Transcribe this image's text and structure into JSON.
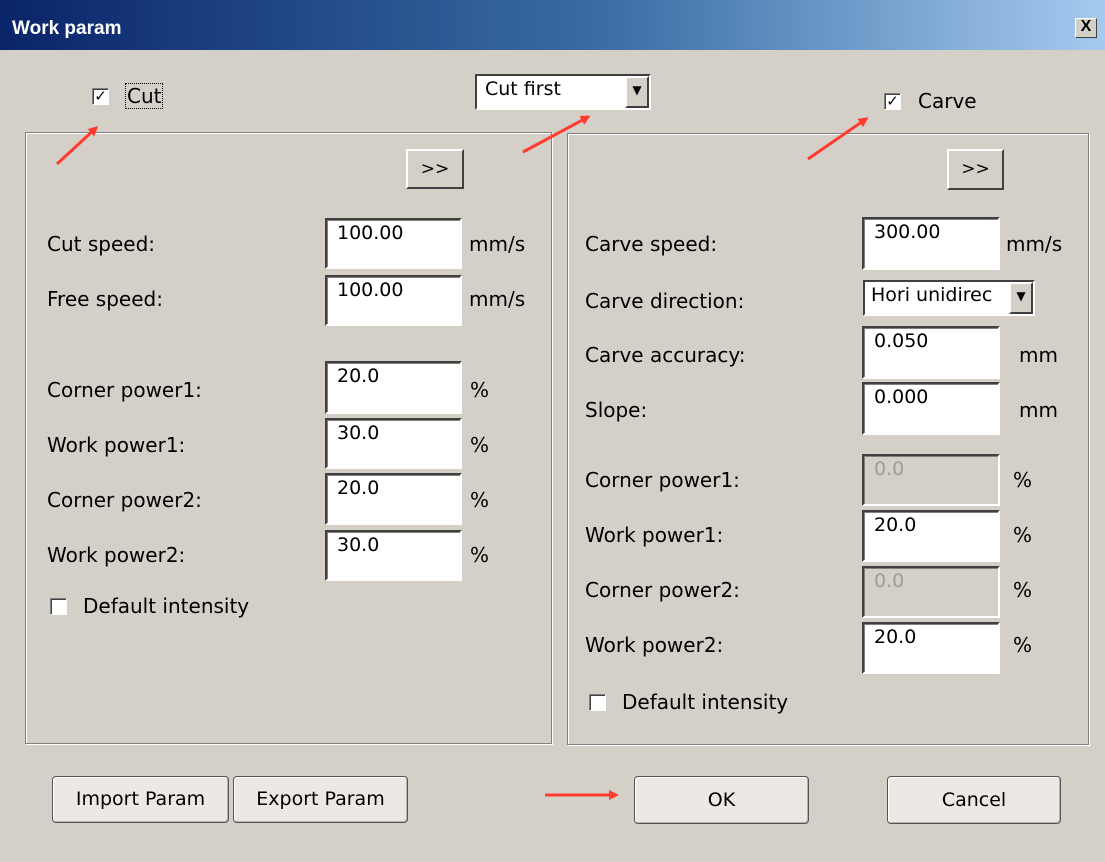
{
  "window": {
    "title": "Work param",
    "close_label": "X"
  },
  "order_select": {
    "value": "Cut first"
  },
  "cut": {
    "enabled_label": "Cut",
    "enabled": true,
    "more_label": ">>",
    "rows": [
      {
        "label": "Cut speed:",
        "value": "100.00",
        "unit": "mm/s"
      },
      {
        "label": "Free speed:",
        "value": "100.00",
        "unit": "mm/s"
      },
      {
        "label": "Corner power1:",
        "value": "20.0",
        "unit": "%"
      },
      {
        "label": "Work power1:",
        "value": "30.0",
        "unit": "%"
      },
      {
        "label": "Corner power2:",
        "value": "20.0",
        "unit": "%"
      },
      {
        "label": "Work power2:",
        "value": "30.0",
        "unit": "%"
      }
    ],
    "default_intensity_label": "Default intensity",
    "default_intensity": false
  },
  "carve": {
    "enabled_label": "Carve",
    "enabled": true,
    "more_label": ">>",
    "speed": {
      "label": "Carve speed:",
      "value": "300.00",
      "unit": "mm/s"
    },
    "direction": {
      "label": "Carve direction:",
      "value": "Hori unidirec"
    },
    "accuracy": {
      "label": "Carve accuracy:",
      "value": "0.050",
      "unit": "mm"
    },
    "slope": {
      "label": "Slope:",
      "value": "0.000",
      "unit": "mm"
    },
    "corner_power1": {
      "label": "Corner power1:",
      "value": "0.0",
      "unit": "%"
    },
    "work_power1": {
      "label": "Work power1:",
      "value": "20.0",
      "unit": "%"
    },
    "corner_power2": {
      "label": "Corner power2:",
      "value": "0.0",
      "unit": "%"
    },
    "work_power2": {
      "label": "Work power2:",
      "value": "20.0",
      "unit": "%"
    },
    "default_intensity_label": "Default intensity",
    "default_intensity": false
  },
  "buttons": {
    "import": "Import Param",
    "export": "Export Param",
    "ok": "OK",
    "cancel": "Cancel"
  },
  "colors": {
    "annotation_arrow": "#ff3b30",
    "title_gradient_start": "#0a246a"
  }
}
